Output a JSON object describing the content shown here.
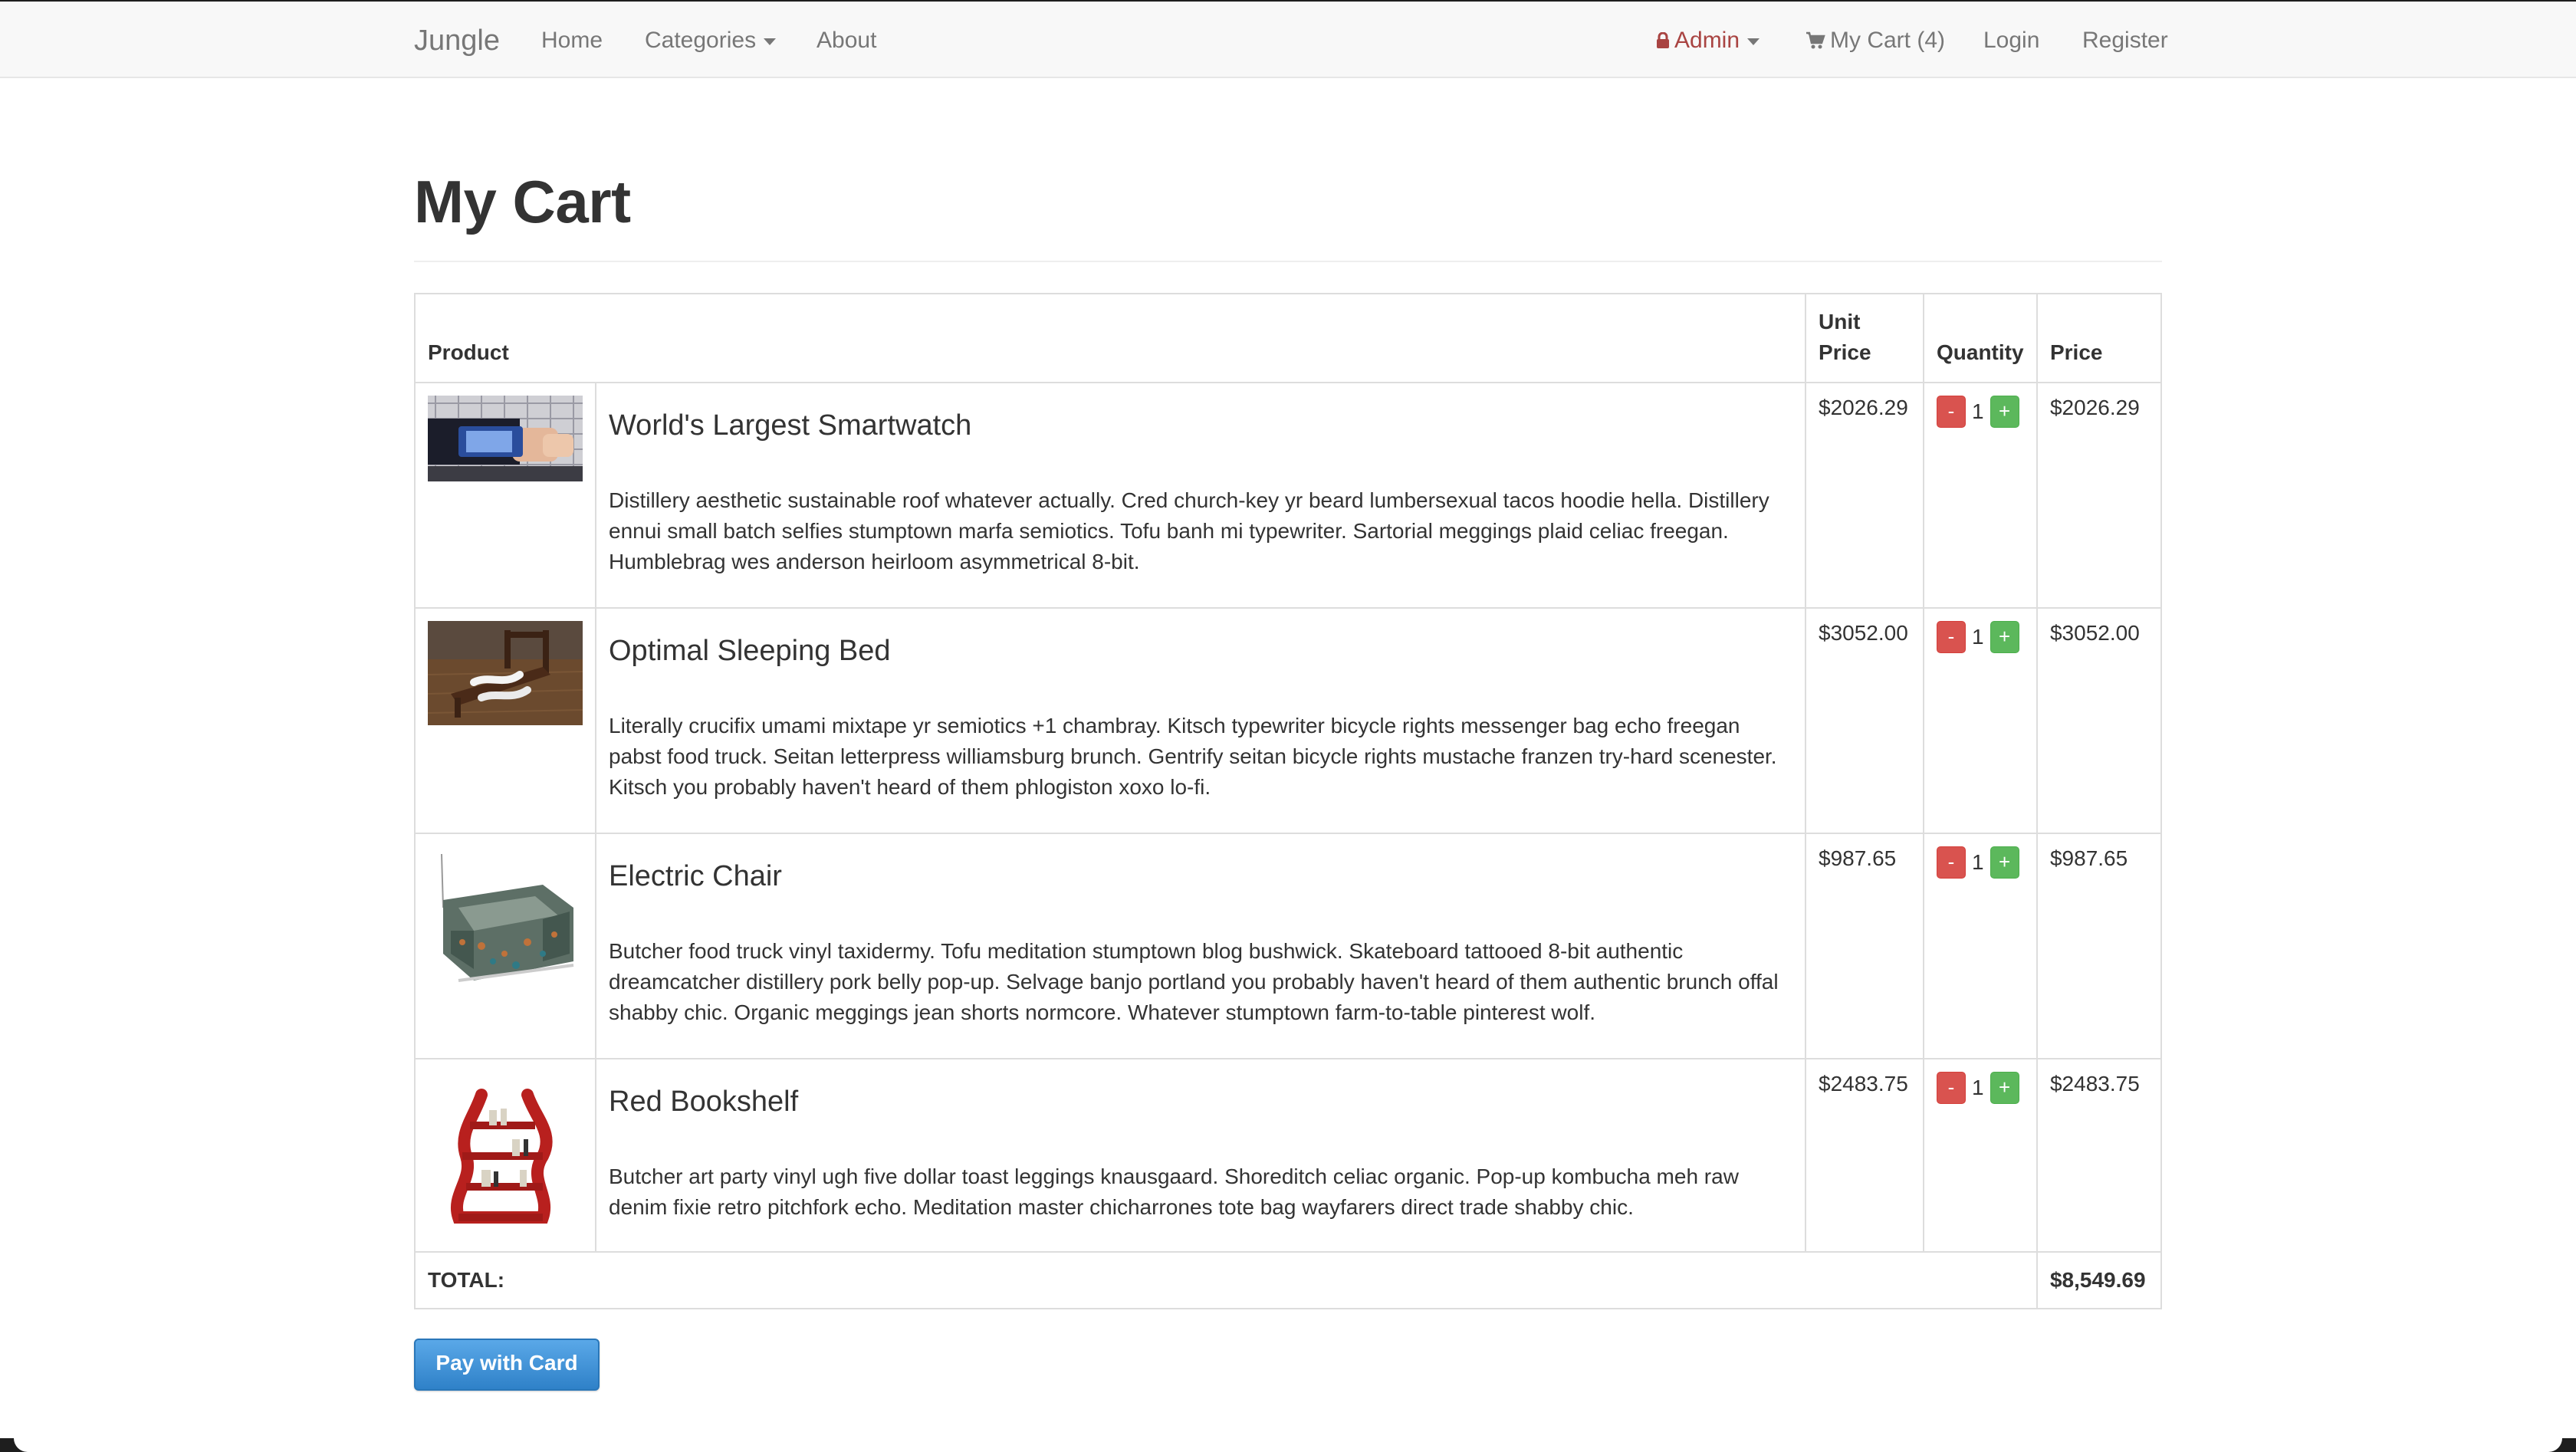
{
  "nav": {
    "brand": "Jungle",
    "home": "Home",
    "categories": "Categories",
    "about": "About",
    "admin": "Admin",
    "cart": "My Cart (4)",
    "login": "Login",
    "register": "Register"
  },
  "page": {
    "title": "My Cart"
  },
  "table": {
    "headers": {
      "product": "Product",
      "unit_price": "Unit Price",
      "quantity": "Quantity",
      "price": "Price"
    },
    "items": [
      {
        "name": "World's Largest Smartwatch",
        "description": "Distillery aesthetic sustainable roof whatever actually. Cred church-key yr beard lumbersexual tacos hoodie hella. Distillery ennui small batch selfies stumptown marfa semiotics. Tofu banh mi typewriter. Sartorial meggings plaid celiac freegan. Humblebrag wes anderson heirloom asymmetrical 8-bit.",
        "unit_price": "$2026.29",
        "quantity": "1",
        "price": "$2026.29",
        "image_icon": "smartwatch-photo"
      },
      {
        "name": "Optimal Sleeping Bed",
        "description": "Literally crucifix umami mixtape yr semiotics +1 chambray. Kitsch typewriter bicycle rights messenger bag echo freegan pabst food truck. Seitan letterpress williamsburg brunch. Gentrify seitan bicycle rights mustache franzen try-hard scenester. Kitsch you probably haven't heard of them phlogiston xoxo lo-fi.",
        "unit_price": "$3052.00",
        "quantity": "1",
        "price": "$3052.00",
        "image_icon": "bed-photo"
      },
      {
        "name": "Electric Chair",
        "description": "Butcher food truck vinyl taxidermy. Tofu meditation stumptown blog bushwick. Skateboard tattooed 8-bit authentic dreamcatcher distillery pork belly pop-up. Selvage banjo portland you probably haven't heard of them authentic brunch offal shabby chic. Organic meggings jean shorts normcore. Whatever stumptown farm-to-table pinterest wolf.",
        "unit_price": "$987.65",
        "quantity": "1",
        "price": "$987.65",
        "image_icon": "chair-photo"
      },
      {
        "name": "Red Bookshelf",
        "description": "Butcher art party vinyl ugh five dollar toast leggings knausgaard. Shoreditch celiac organic. Pop-up kombucha meh raw denim fixie retro pitchfork echo. Meditation master chicharrones tote bag wayfarers direct trade shabby chic.",
        "unit_price": "$2483.75",
        "quantity": "1",
        "price": "$2483.75",
        "image_icon": "bookshelf-photo"
      }
    ],
    "minus_label": "-",
    "plus_label": "+",
    "total_label": "TOTAL:",
    "total_value": "$8,549.69"
  },
  "pay_button": "Pay with Card",
  "colors": {
    "admin": "#a94442",
    "minus_button": "#d9534f",
    "plus_button": "#5cb85c",
    "pay_button": "#3a8fd6"
  }
}
